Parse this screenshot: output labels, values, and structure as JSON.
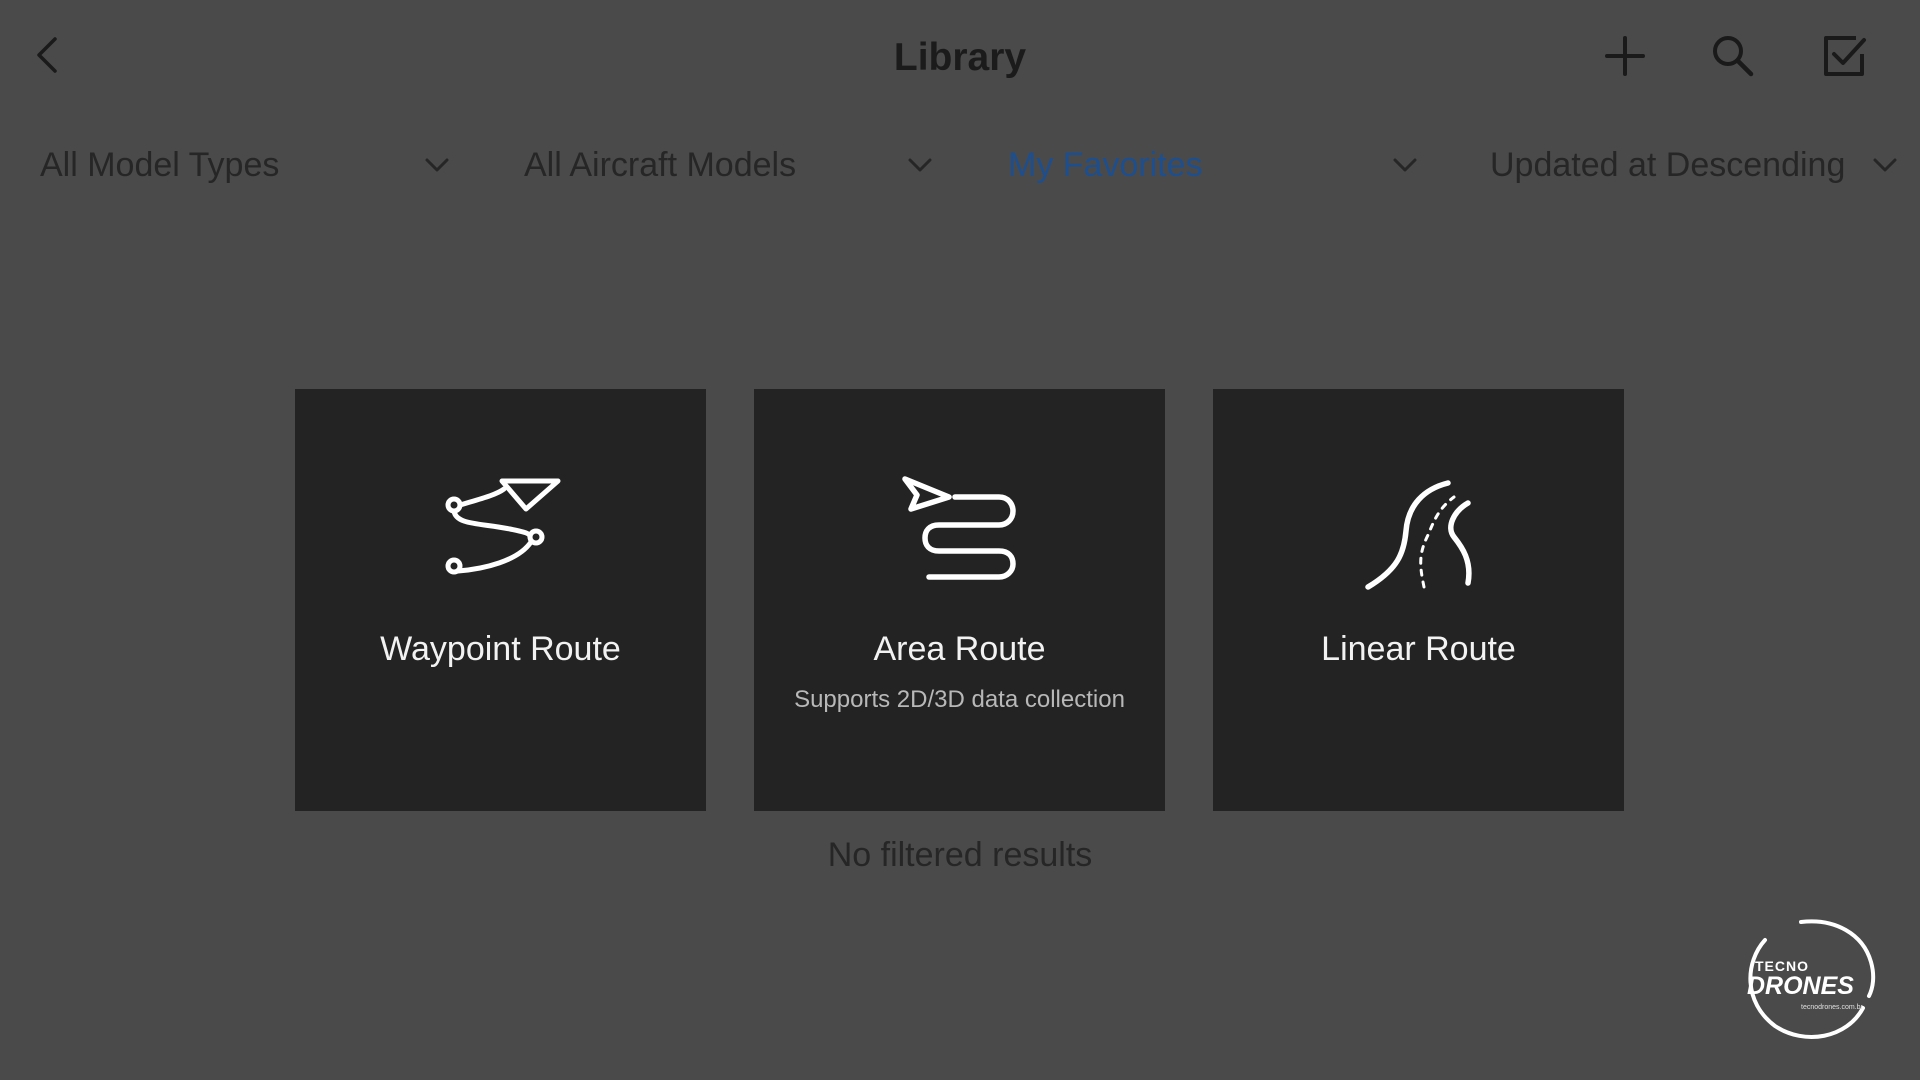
{
  "header": {
    "title": "Library",
    "back_icon": "chevron-left-icon",
    "actions": [
      {
        "name": "add",
        "icon": "plus-icon"
      },
      {
        "name": "search",
        "icon": "magnifier-icon"
      },
      {
        "name": "select",
        "icon": "checkbox-icon"
      }
    ]
  },
  "filters": [
    {
      "label": "All Model Types",
      "active": false
    },
    {
      "label": "All Aircraft Models",
      "active": false
    },
    {
      "label": "My Favorites",
      "active": true
    },
    {
      "label": "Updated at Descending",
      "active": false
    }
  ],
  "route_types": [
    {
      "title": "Waypoint Route",
      "subtitle": "",
      "icon": "waypoint-route-icon"
    },
    {
      "title": "Area Route",
      "subtitle": "Supports 2D/3D data collection",
      "icon": "area-route-icon"
    },
    {
      "title": "Linear Route",
      "subtitle": "",
      "icon": "linear-route-icon"
    }
  ],
  "empty_message": "No filtered results",
  "watermark": {
    "line1": "TECNO",
    "line2": "DRONES",
    "url": "tecnodrones.com.br"
  },
  "colors": {
    "background": "#4a4a4a",
    "card": "#232323",
    "active_filter": "#1d4f8f"
  }
}
